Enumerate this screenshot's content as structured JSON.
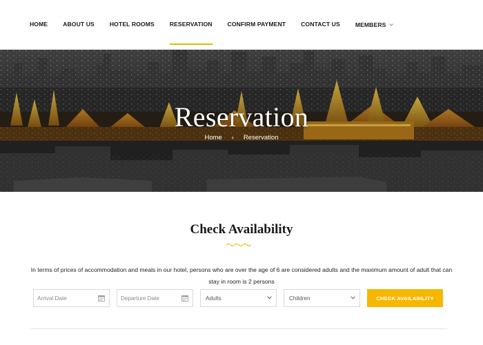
{
  "nav": {
    "items": [
      {
        "label": "HOME"
      },
      {
        "label": "ABOUT US"
      },
      {
        "label": "HOTEL ROOMS"
      },
      {
        "label": "RESERVATION",
        "active": true
      },
      {
        "label": "CONFIRM PAYMENT"
      },
      {
        "label": "CONTACT US"
      },
      {
        "label": "MEMBERS",
        "icon": "chevron-down-icon"
      }
    ]
  },
  "hero": {
    "title": "Reservation",
    "breadcrumb": {
      "home": "Home",
      "separator": "›",
      "current": "Reservation"
    }
  },
  "availability": {
    "title": "Check Availability",
    "description": "In terms of prices of accommodation and meals in our hotel, persons who are over the age of 6 are considered adults and the maximum amount of adult that can stay in room is 2 persons",
    "arrival_placeholder": "Arrival Date",
    "departure_placeholder": "Departure Date",
    "adults_label": "Adults",
    "children_label": "Children",
    "button_label": "CHECK AVAILABILITY"
  },
  "colors": {
    "accent": "#f5b700",
    "active_underline": "#e6b800",
    "heading": "#1a1a1a"
  }
}
